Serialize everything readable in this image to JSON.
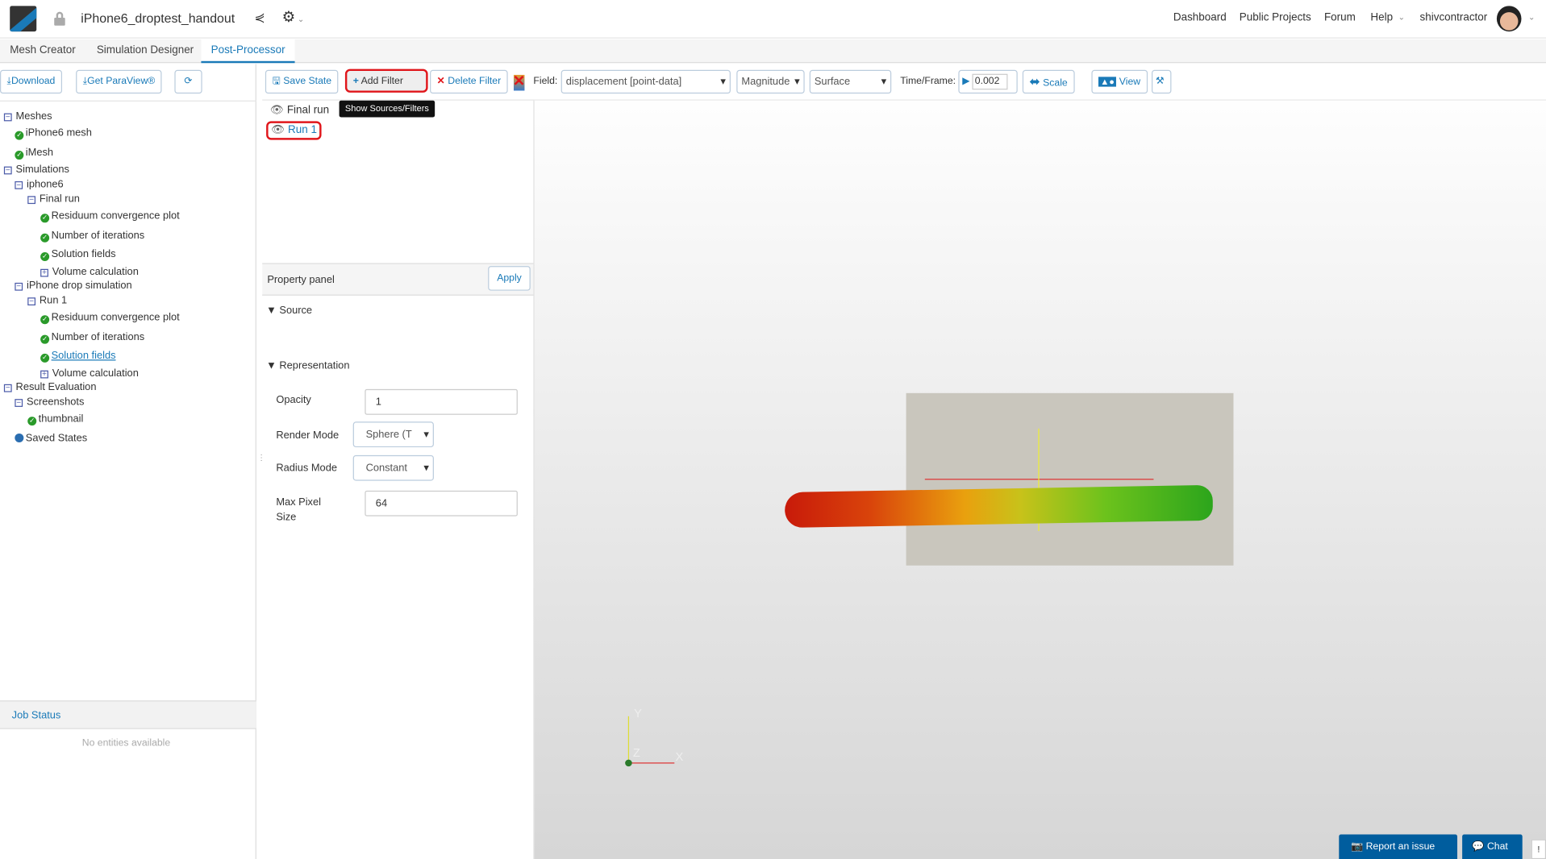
{
  "header": {
    "project_title": "iPhone6_droptest_handout",
    "nav": [
      "Dashboard",
      "Public Projects",
      "Forum",
      "Help"
    ],
    "username": "shivcontractor"
  },
  "tabs": [
    "Mesh Creator",
    "Simulation Designer",
    "Post-Processor"
  ],
  "left_toolbar": {
    "download": "Download",
    "paraview": "Get ParaView®"
  },
  "tree": [
    {
      "label": "Meshes",
      "type": "collapse",
      "level": 0
    },
    {
      "label": "iPhone6 mesh",
      "type": "ok",
      "level": 1
    },
    {
      "label": "iMesh",
      "type": "ok",
      "level": 1
    },
    {
      "label": "Simulations",
      "type": "collapse",
      "level": 0
    },
    {
      "label": "iphone6",
      "type": "collapse",
      "level": 1
    },
    {
      "label": "Final run",
      "type": "collapse",
      "level": 2
    },
    {
      "label": "Residuum convergence plot",
      "type": "ok",
      "level": 3
    },
    {
      "label": "Number of iterations",
      "type": "ok",
      "level": 3
    },
    {
      "label": "Solution fields",
      "type": "ok",
      "level": 3
    },
    {
      "label": "Volume calculation",
      "type": "expand",
      "level": 3
    },
    {
      "label": "iPhone drop simulation",
      "type": "collapse",
      "level": 1
    },
    {
      "label": "Run 1",
      "type": "collapse",
      "level": 2
    },
    {
      "label": "Residuum convergence plot",
      "type": "ok",
      "level": 3
    },
    {
      "label": "Number of iterations",
      "type": "ok",
      "level": 3
    },
    {
      "label": "Solution fields",
      "type": "ok",
      "level": 3,
      "selected": true
    },
    {
      "label": "Volume calculation",
      "type": "expand",
      "level": 3
    },
    {
      "label": "Result Evaluation",
      "type": "collapse",
      "level": 0
    },
    {
      "label": "Screenshots",
      "type": "collapse",
      "level": 1
    },
    {
      "label": "thumbnail",
      "type": "ok",
      "level": 2
    },
    {
      "label": "Saved States",
      "type": "dot",
      "level": 1
    }
  ],
  "job_status": {
    "title": "Job Status",
    "empty": "No entities available"
  },
  "toolbar": {
    "save_state": "Save State",
    "add_filter": "Add Filter",
    "tooltip": "Show Sources/Filters",
    "delete_filter": "Delete Filter",
    "field_label": "Field:",
    "field_value": "displacement [point-data]",
    "component": "Magnitude",
    "representation": "Surface",
    "time_label": "Time/Frame:",
    "time_value": "0.002",
    "scale": "Scale",
    "view": "View"
  },
  "pipeline": [
    "Final run",
    "Run 1"
  ],
  "property_panel": {
    "title": "Property panel",
    "apply": "Apply",
    "source": "Source",
    "representation": "Representation",
    "opacity_label": "Opacity",
    "opacity": "1",
    "render_mode_label": "Render Mode",
    "render_mode": "Sphere (T",
    "radius_mode_label": "Radius Mode",
    "radius_mode": "Constant",
    "max_pixel_label": "Max Pixel Size",
    "max_pixel": "64"
  },
  "axes": {
    "y": "Y",
    "z": "Z",
    "x": "X"
  },
  "footer": {
    "report": "Report an issue",
    "chat": "Chat"
  },
  "colors": {
    "accent": "#1a7ab8",
    "footer_button": "#005d9e",
    "highlight": "#e0161b"
  }
}
